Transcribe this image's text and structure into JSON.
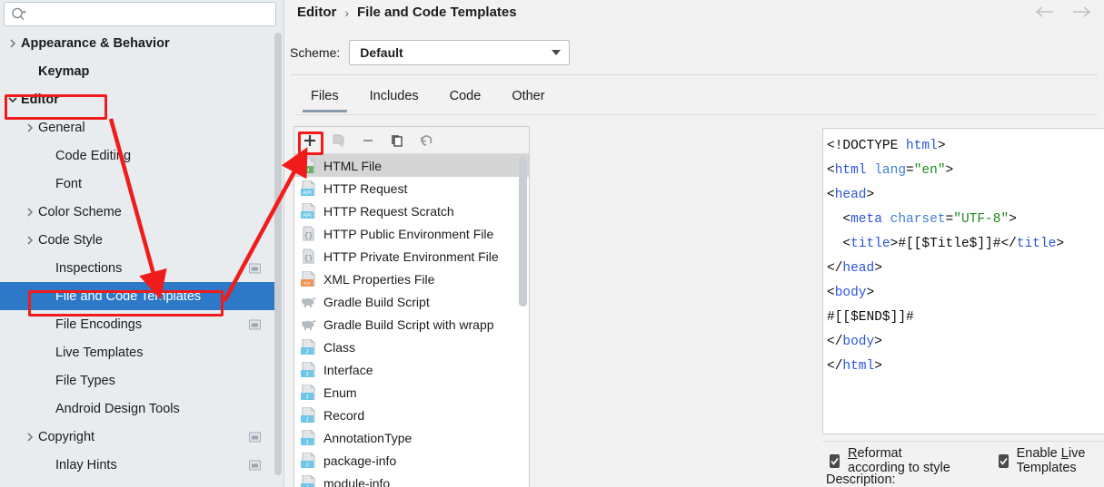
{
  "search": {
    "placeholder": "",
    "value": "",
    "icon": "search-icon"
  },
  "sidebar": {
    "items": [
      {
        "label": "Appearance & Behavior",
        "indent": 0,
        "arrow": "chevron-right",
        "bold": true,
        "selected": false,
        "badge": false
      },
      {
        "label": "Keymap",
        "indent": 1,
        "arrow": "none",
        "bold": true,
        "selected": false,
        "badge": false
      },
      {
        "label": "Editor",
        "indent": 0,
        "arrow": "chevron-down",
        "bold": true,
        "selected": false,
        "badge": false
      },
      {
        "label": "General",
        "indent": 1,
        "arrow": "chevron-right",
        "bold": false,
        "selected": false,
        "badge": false
      },
      {
        "label": "Code Editing",
        "indent": 2,
        "arrow": "none",
        "bold": false,
        "selected": false,
        "badge": false
      },
      {
        "label": "Font",
        "indent": 2,
        "arrow": "none",
        "bold": false,
        "selected": false,
        "badge": false
      },
      {
        "label": "Color Scheme",
        "indent": 1,
        "arrow": "chevron-right",
        "bold": false,
        "selected": false,
        "badge": false
      },
      {
        "label": "Code Style",
        "indent": 1,
        "arrow": "chevron-right",
        "bold": false,
        "selected": false,
        "badge": false
      },
      {
        "label": "Inspections",
        "indent": 2,
        "arrow": "none",
        "bold": false,
        "selected": false,
        "badge": true
      },
      {
        "label": "File and Code Templates",
        "indent": 2,
        "arrow": "none",
        "bold": false,
        "selected": true,
        "badge": false
      },
      {
        "label": "File Encodings",
        "indent": 2,
        "arrow": "none",
        "bold": false,
        "selected": false,
        "badge": true
      },
      {
        "label": "Live Templates",
        "indent": 2,
        "arrow": "none",
        "bold": false,
        "selected": false,
        "badge": false
      },
      {
        "label": "File Types",
        "indent": 2,
        "arrow": "none",
        "bold": false,
        "selected": false,
        "badge": false
      },
      {
        "label": "Android Design Tools",
        "indent": 2,
        "arrow": "none",
        "bold": false,
        "selected": false,
        "badge": false
      },
      {
        "label": "Copyright",
        "indent": 1,
        "arrow": "chevron-right",
        "bold": false,
        "selected": false,
        "badge": true
      },
      {
        "label": "Inlay Hints",
        "indent": 2,
        "arrow": "none",
        "bold": false,
        "selected": false,
        "badge": true
      }
    ]
  },
  "header": {
    "breadcrumb": {
      "parent": "Editor",
      "separator": "›",
      "current": "File and Code Templates"
    },
    "nav": {
      "back": "←",
      "forward": "→"
    }
  },
  "scheme": {
    "label": "Scheme:",
    "value": "Default"
  },
  "tabs": [
    {
      "label": "Files",
      "active": true
    },
    {
      "label": "Includes",
      "active": false
    },
    {
      "label": "Code",
      "active": false
    },
    {
      "label": "Other",
      "active": false
    }
  ],
  "list_toolbar": [
    {
      "name": "add-template-button",
      "glyph": "+",
      "enabled": true
    },
    {
      "name": "save-as-template-button",
      "glyph": "save-as",
      "enabled": false
    },
    {
      "name": "remove-template-button",
      "glyph": "−",
      "enabled": true
    },
    {
      "name": "copy-template-button",
      "glyph": "copy",
      "enabled": true
    },
    {
      "name": "reset-template-button",
      "glyph": "↺",
      "enabled": true
    }
  ],
  "templates": [
    {
      "label": "HTML File",
      "icon": "html-file-icon",
      "selected": true
    },
    {
      "label": "HTTP Request",
      "icon": "api-file-icon",
      "selected": false
    },
    {
      "label": "HTTP Request Scratch",
      "icon": "api-file-icon",
      "selected": false
    },
    {
      "label": "HTTP Public Environment File",
      "icon": "json-file-icon",
      "selected": false
    },
    {
      "label": "HTTP Private Environment File",
      "icon": "json-file-icon",
      "selected": false
    },
    {
      "label": "XML Properties File",
      "icon": "xml-file-icon",
      "selected": false
    },
    {
      "label": "Gradle Build Script",
      "icon": "gradle-icon",
      "selected": false
    },
    {
      "label": "Gradle Build Script with wrapp",
      "icon": "gradle-icon",
      "selected": false
    },
    {
      "label": "Class",
      "icon": "java-file-icon",
      "selected": false
    },
    {
      "label": "Interface",
      "icon": "java-file-icon",
      "selected": false
    },
    {
      "label": "Enum",
      "icon": "java-file-icon",
      "selected": false
    },
    {
      "label": "Record",
      "icon": "java-file-icon",
      "selected": false
    },
    {
      "label": "AnnotationType",
      "icon": "java-file-icon",
      "selected": false
    },
    {
      "label": "package-info",
      "icon": "java-file-icon",
      "selected": false
    },
    {
      "label": "module-info",
      "icon": "java-file-icon",
      "selected": false
    }
  ],
  "editor": {
    "lines": [
      [
        {
          "t": "<!DOCTYPE ",
          "c": "k-plain"
        },
        {
          "t": "html",
          "c": "k-name"
        },
        {
          "t": ">",
          "c": "k-plain"
        }
      ],
      [
        {
          "t": "<",
          "c": "k-plain"
        },
        {
          "t": "html",
          "c": "k-name"
        },
        {
          "t": " ",
          "c": "k-plain"
        },
        {
          "t": "lang",
          "c": "k-attr"
        },
        {
          "t": "=",
          "c": "k-plain"
        },
        {
          "t": "\"en\"",
          "c": "k-str"
        },
        {
          "t": ">",
          "c": "k-plain"
        }
      ],
      [
        {
          "t": "<",
          "c": "k-plain"
        },
        {
          "t": "head",
          "c": "k-name"
        },
        {
          "t": ">",
          "c": "k-plain"
        }
      ],
      [
        {
          "t": "  <",
          "c": "k-plain"
        },
        {
          "t": "meta",
          "c": "k-name"
        },
        {
          "t": " ",
          "c": "k-plain"
        },
        {
          "t": "charset",
          "c": "k-attr"
        },
        {
          "t": "=",
          "c": "k-plain"
        },
        {
          "t": "\"UTF-8\"",
          "c": "k-str"
        },
        {
          "t": ">",
          "c": "k-plain"
        }
      ],
      [
        {
          "t": "  <",
          "c": "k-plain"
        },
        {
          "t": "title",
          "c": "k-name"
        },
        {
          "t": ">#[[$Title$]]#</",
          "c": "k-plain"
        },
        {
          "t": "title",
          "c": "k-name"
        },
        {
          "t": ">",
          "c": "k-plain"
        }
      ],
      [
        {
          "t": "</",
          "c": "k-plain"
        },
        {
          "t": "head",
          "c": "k-name"
        },
        {
          "t": ">",
          "c": "k-plain"
        }
      ],
      [
        {
          "t": "<",
          "c": "k-plain"
        },
        {
          "t": "body",
          "c": "k-name"
        },
        {
          "t": ">",
          "c": "k-plain"
        }
      ],
      [
        {
          "t": "#[[$END$]]#",
          "c": "k-plain"
        }
      ],
      [
        {
          "t": "</",
          "c": "k-plain"
        },
        {
          "t": "body",
          "c": "k-name"
        },
        {
          "t": ">",
          "c": "k-plain"
        }
      ],
      [
        {
          "t": "</",
          "c": "k-plain"
        },
        {
          "t": "html",
          "c": "k-name"
        },
        {
          "t": ">",
          "c": "k-plain"
        }
      ]
    ]
  },
  "options": {
    "reformat": {
      "label_pre": "",
      "label_mn": "R",
      "label_post": "eformat according to style",
      "checked": true
    },
    "live_templates": {
      "label_pre": "Enable ",
      "label_mn": "L",
      "label_post": "ive Templates",
      "checked": true
    }
  },
  "description_label": "Description:",
  "colors": {
    "selection_blue": "#2d79c7",
    "annotation_red": "#f01c1c",
    "list_selection_gray": "#d5d5d5",
    "tab_underline": "#8a9bab",
    "sidebar_bg": "#e8ecef"
  }
}
